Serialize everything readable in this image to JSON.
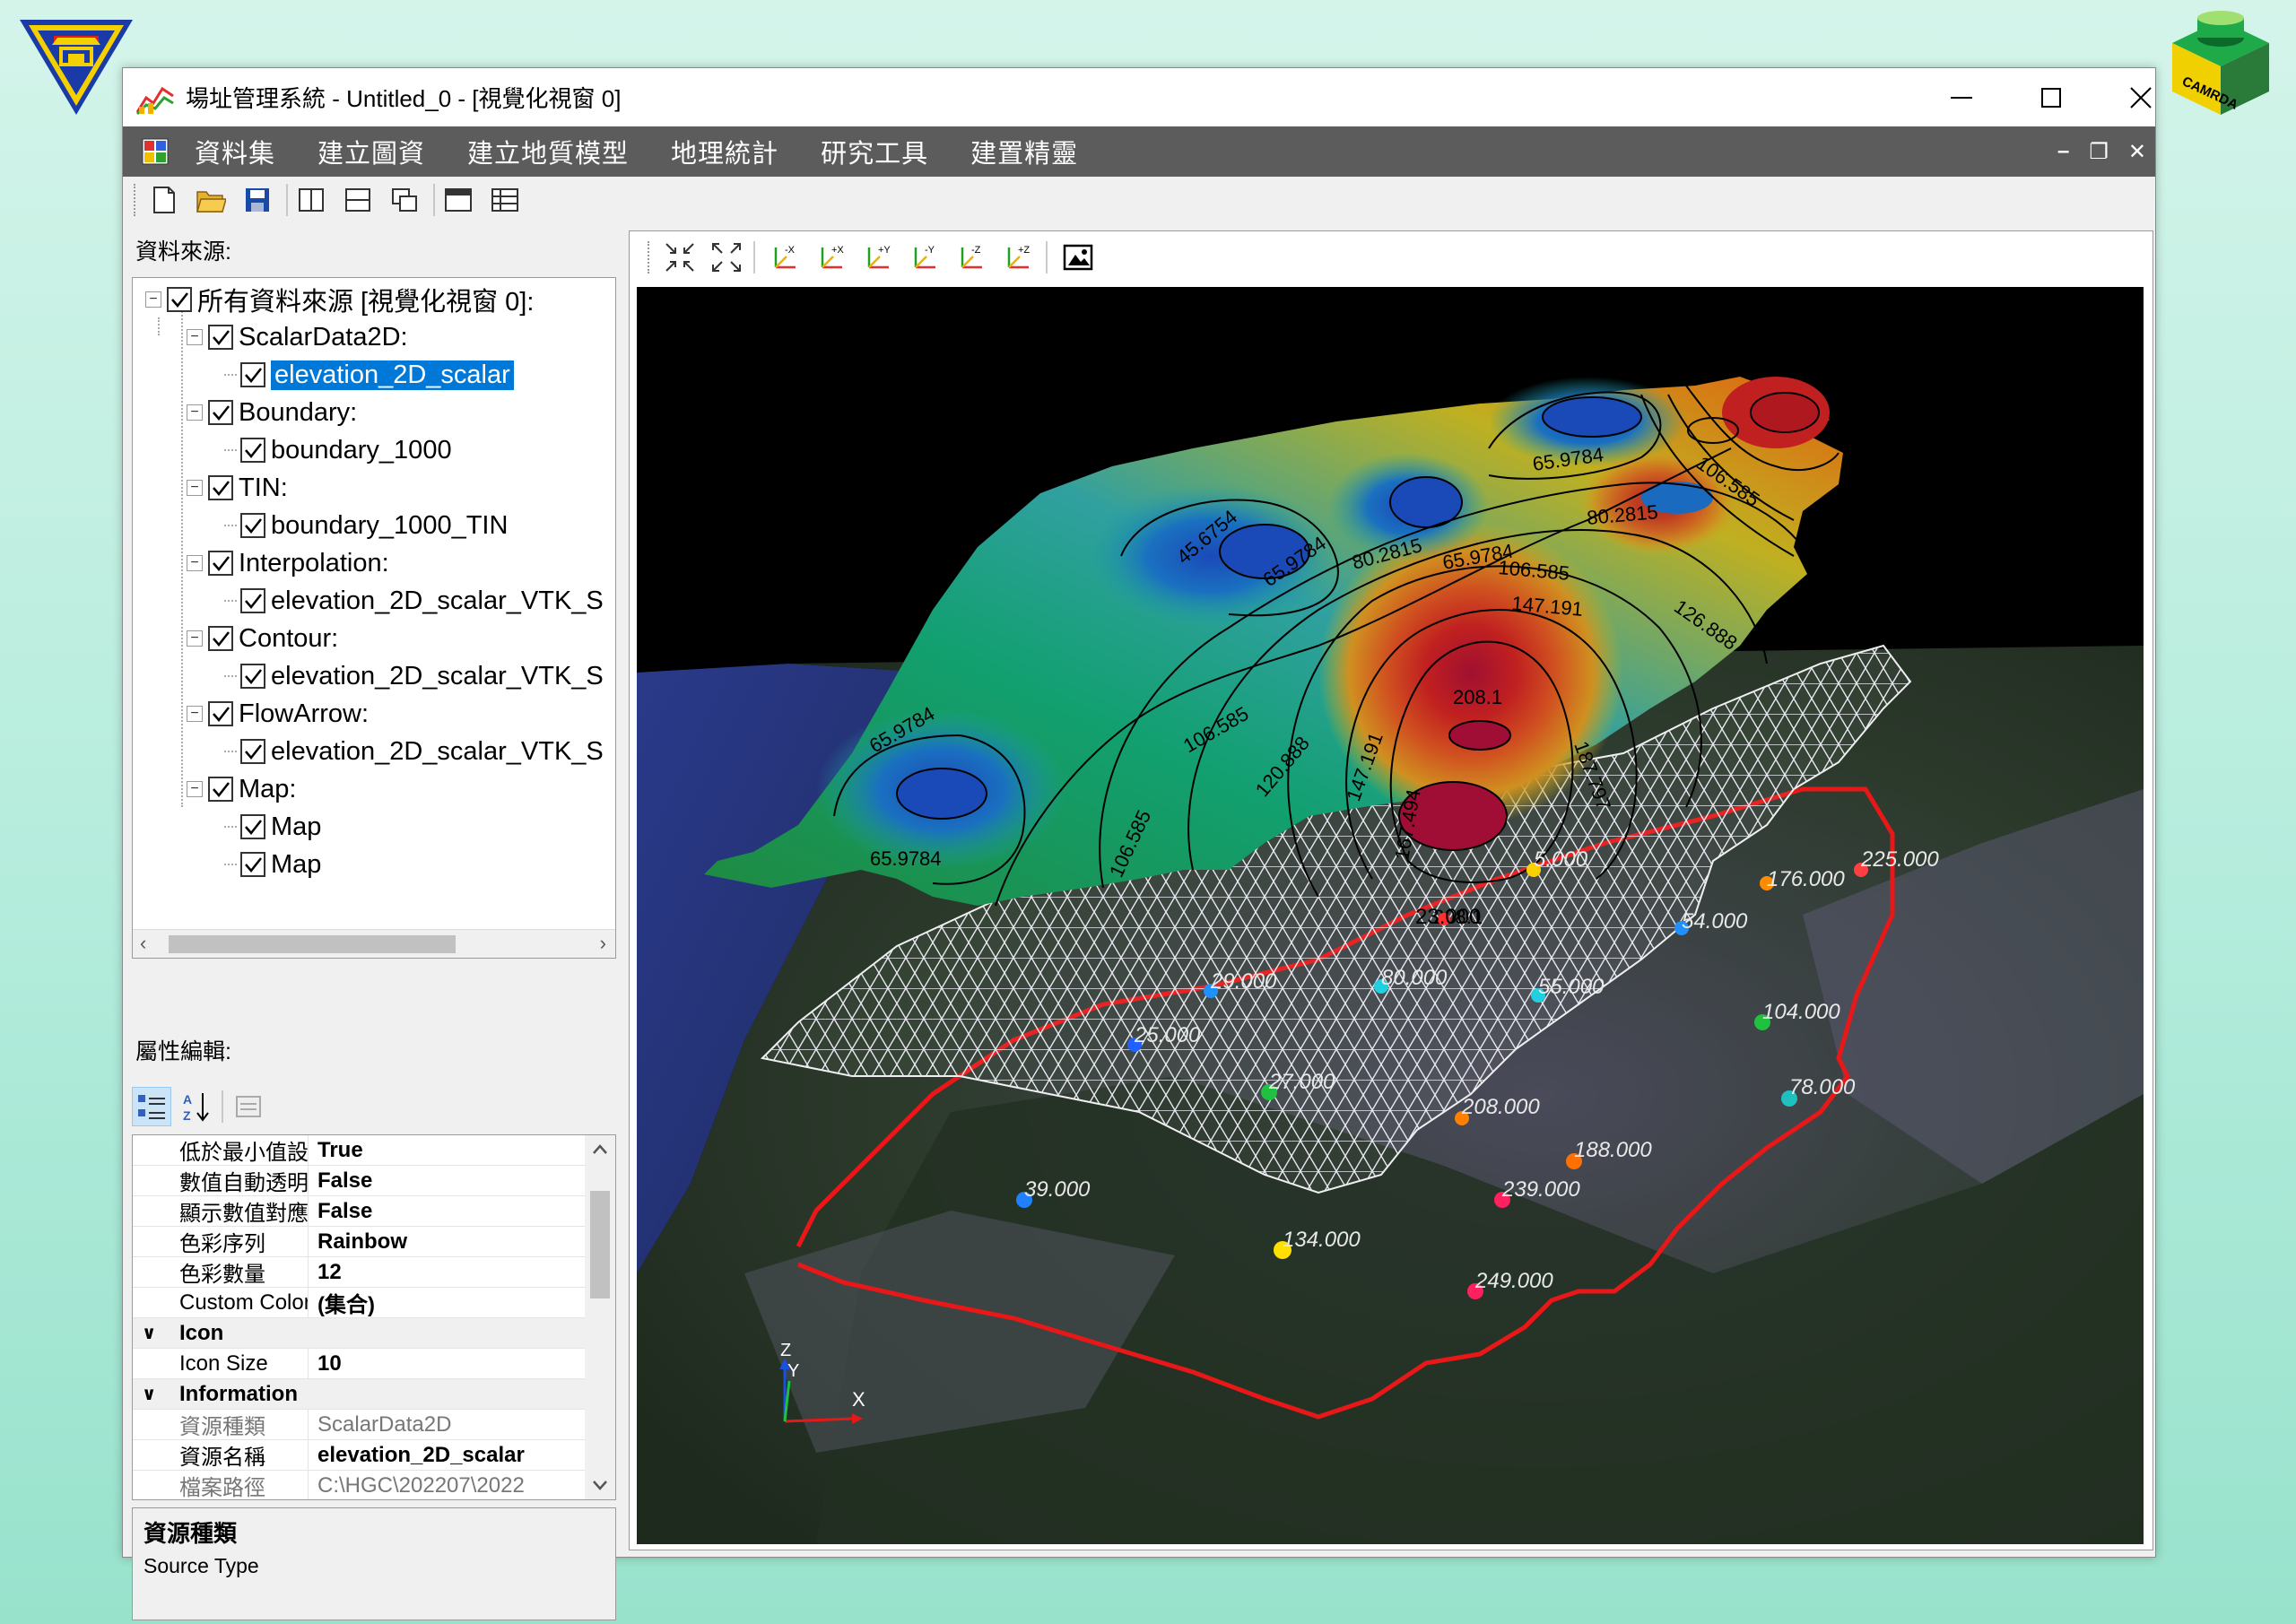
{
  "window": {
    "title": "場址管理系統 - Untitled_0 - [視覺化視窗 0]"
  },
  "menu": [
    "資料集",
    "建立圖資",
    "建立地質模型",
    "地理統計",
    "研究工具",
    "建置精靈"
  ],
  "panels": {
    "data_source_label": "資料來源:",
    "property_label": "屬性編輯:"
  },
  "tree": {
    "root": "所有資料來源 [視覺化視窗 0]:",
    "groups": [
      {
        "label": "ScalarData2D:",
        "children": [
          "elevation_2D_scalar"
        ]
      },
      {
        "label": "Boundary:",
        "children": [
          "boundary_1000"
        ]
      },
      {
        "label": "TIN:",
        "children": [
          "boundary_1000_TIN"
        ]
      },
      {
        "label": "Interpolation:",
        "children": [
          "elevation_2D_scalar_VTK_S"
        ]
      },
      {
        "label": "Contour:",
        "children": [
          "elevation_2D_scalar_VTK_S"
        ]
      },
      {
        "label": "FlowArrow:",
        "children": [
          "elevation_2D_scalar_VTK_S"
        ]
      },
      {
        "label": "Map:",
        "children": [
          "Map",
          "Map"
        ]
      }
    ]
  },
  "properties": [
    {
      "name": "低於最小值設為",
      "value": "True"
    },
    {
      "name": "數值自動透明分",
      "value": "False"
    },
    {
      "name": "顯示數值對應標",
      "value": "False"
    },
    {
      "name": "色彩序列",
      "value": "Rainbow"
    },
    {
      "name": "色彩數量",
      "value": "12"
    },
    {
      "name": "Custom Color Map",
      "value": "(集合)"
    },
    {
      "category": "Icon"
    },
    {
      "name": "Icon Size",
      "value": "10"
    },
    {
      "category": "Information"
    },
    {
      "name": "資源種類",
      "value": "ScalarData2D",
      "gray": true
    },
    {
      "name": "資源名稱",
      "value": "elevation_2D_scalar"
    },
    {
      "name": "檔案路徑",
      "value": "C:\\HGC\\202207\\2022",
      "gray": true
    }
  ],
  "description": {
    "title": "資源種類",
    "text": "Source Type"
  },
  "scene": {
    "contour_labels": [
      {
        "text": "65.9784",
        "angle": -10
      },
      {
        "text": "65.9784",
        "angle": -8
      },
      {
        "text": "80.2815",
        "angle": -5
      },
      {
        "text": "106.585",
        "angle": 8
      },
      {
        "text": "45.6754",
        "angle": -40
      },
      {
        "text": "65.9784",
        "angle": -35
      },
      {
        "text": "80.2815",
        "angle": -15
      },
      {
        "text": "106.585",
        "angle": 5
      },
      {
        "text": "147.191",
        "angle": 5
      },
      {
        "text": "126.888",
        "angle": 35
      },
      {
        "text": "65.9784",
        "angle": -30
      },
      {
        "text": "106.585",
        "angle": -30
      },
      {
        "text": "120.888",
        "angle": -50
      },
      {
        "text": "147.191",
        "angle": -70
      },
      {
        "text": "208.1",
        "angle": 0
      },
      {
        "text": "187.797",
        "angle": 70
      },
      {
        "text": "167.494",
        "angle": -80
      },
      {
        "text": "106.585",
        "angle": -65
      },
      {
        "text": "65.9784",
        "angle": 0
      },
      {
        "text": "208.1",
        "angle": 0
      }
    ],
    "points": [
      {
        "label": "5.000",
        "color": "#ffd000"
      },
      {
        "label": "225.000",
        "color": "#ff4040"
      },
      {
        "label": "176.000",
        "color": "#ff8c00"
      },
      {
        "label": "23.000",
        "color": "#ff3030"
      },
      {
        "label": "54.000",
        "color": "#2090ff"
      },
      {
        "label": "29.000",
        "color": "#2090ff"
      },
      {
        "label": "80.000",
        "color": "#20d0e0"
      },
      {
        "label": "55.000",
        "color": "#20d0e0"
      },
      {
        "label": "104.000",
        "color": "#20c040"
      },
      {
        "label": "25.000",
        "color": "#2060ff"
      },
      {
        "label": "27.000",
        "color": "#20c040"
      },
      {
        "label": "208.000",
        "color": "#ff8000"
      },
      {
        "label": "78.000",
        "color": "#20c0c0"
      },
      {
        "label": "188.000",
        "color": "#ff7000"
      },
      {
        "label": "239.000",
        "color": "#ff2060"
      },
      {
        "label": "39.000",
        "color": "#2080ff"
      },
      {
        "label": "134.000",
        "color": "#ffe000"
      },
      {
        "label": "249.000",
        "color": "#ff2060"
      }
    ],
    "axes": {
      "z": "Z",
      "y": "Y",
      "x": "X"
    }
  }
}
